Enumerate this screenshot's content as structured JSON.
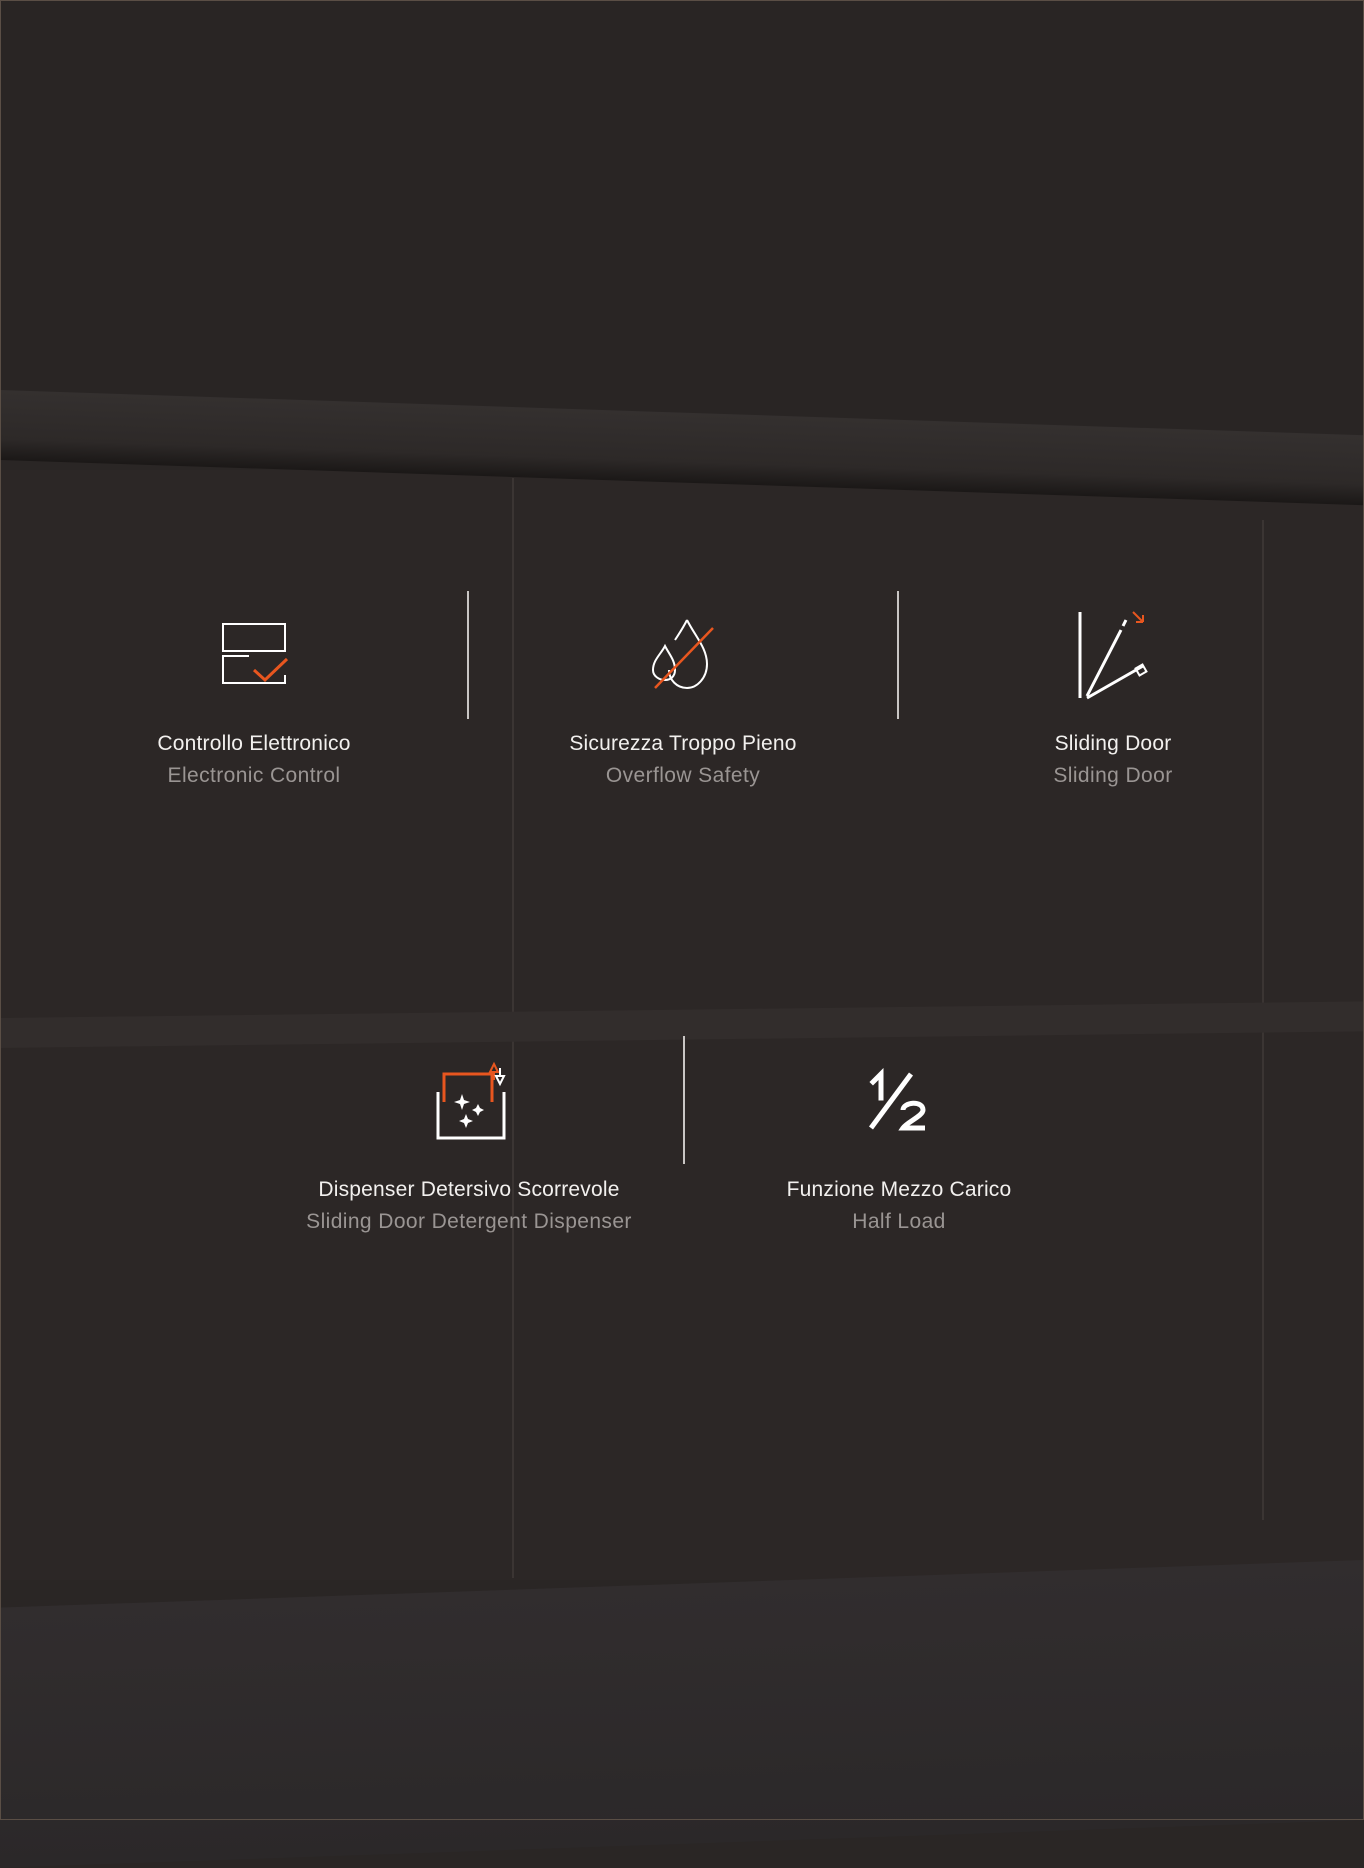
{
  "colors": {
    "accent": "#e8561f",
    "icon_line": "#ffffff",
    "title_text": "#f2f0ee",
    "subtitle_text": "#9a9593",
    "background": "#2a2625"
  },
  "features": [
    {
      "icon": "electronic-control-icon",
      "title": "Controllo Elettronico",
      "subtitle": "Electronic Control"
    },
    {
      "icon": "overflow-safety-icon",
      "title": "Sicurezza Troppo Pieno",
      "subtitle": "Overflow Safety"
    },
    {
      "icon": "sliding-door-icon",
      "title": "Sliding Door",
      "subtitle": "Sliding Door"
    },
    {
      "icon": "detergent-dispenser-icon",
      "title": "Dispenser Detersivo Scorrevole",
      "subtitle": "Sliding Door Detergent Dispenser"
    },
    {
      "icon": "half-load-icon",
      "title": "Funzione Mezzo Carico",
      "subtitle": "Half Load"
    }
  ]
}
